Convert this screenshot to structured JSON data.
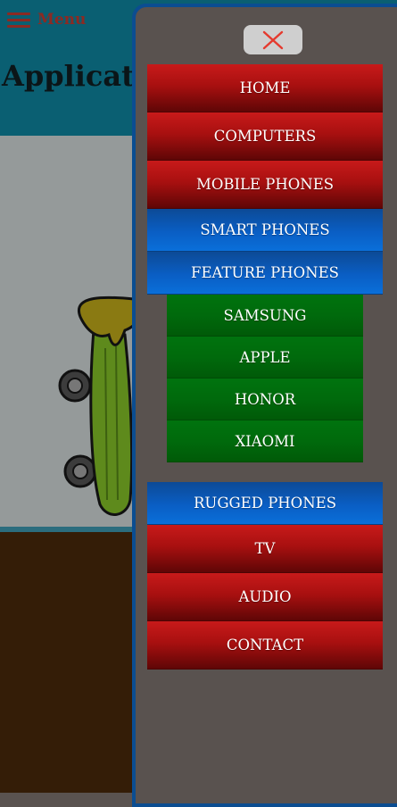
{
  "header": {
    "menu_label": "Menu",
    "title": "Application"
  },
  "drawer": {
    "close_label": "×",
    "items": [
      {
        "label": "HOME"
      },
      {
        "label": "COMPUTERS"
      },
      {
        "label": "MOBILE PHONES"
      },
      {
        "label": "SMART PHONES"
      },
      {
        "label": "FEATURE PHONES"
      },
      {
        "label": "RUGGED PHONES"
      },
      {
        "label": "TV"
      },
      {
        "label": "AUDIO"
      },
      {
        "label": "CONTACT"
      }
    ],
    "feature_phone_brands": [
      {
        "label": "SAMSUNG"
      },
      {
        "label": "APPLE"
      },
      {
        "label": "HONOR"
      },
      {
        "label": "XIAOMI"
      }
    ]
  },
  "colors": {
    "header_bg": "#0a5f72",
    "menu_red": "#a81010",
    "menu_blue": "#0a5ec4",
    "menu_green": "#006a0c",
    "close_icon": "#e53a2e"
  },
  "icons": {
    "menu": "hamburger-icon",
    "close": "close-icon"
  }
}
